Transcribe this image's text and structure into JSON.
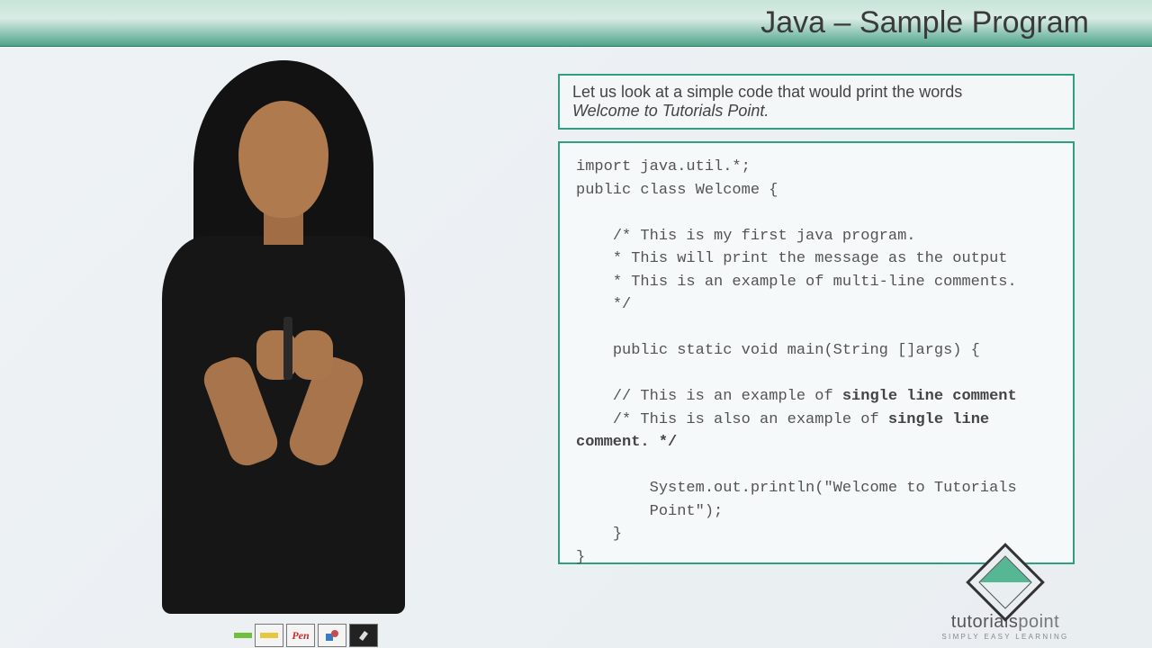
{
  "header": {
    "title": "Java – Sample Program"
  },
  "intro": {
    "line1": "Let us look at a simple code that would print the words",
    "line2": "Welcome to Tutorials Point."
  },
  "code": {
    "l1": "import java.util.*;",
    "l2": "public class Welcome {",
    "l3": "    /* This is my first java program.",
    "l4": "    * This will print the message as the output",
    "l5": "    * This is an example of multi-line comments.",
    "l6": "    */",
    "l7": "    public static void main(String []args) {",
    "l8a": "    // This is an example of ",
    "l8b": "single line comment",
    "l9a": "    /* This is also an example of ",
    "l9b": "single line",
    "l10": "comment. */",
    "l11": "        System.out.println(\"Welcome to Tutorials",
    "l12": "        Point\");",
    "l13": "    }",
    "l14": "}"
  },
  "logo": {
    "main": "tutorials",
    "sub": "point",
    "tagline": "SIMPLY EASY LEARNING"
  },
  "toolbar": {
    "pen_label": "Pen",
    "items": [
      "highlight",
      "marker",
      "pen",
      "shapes",
      "eraser"
    ]
  }
}
